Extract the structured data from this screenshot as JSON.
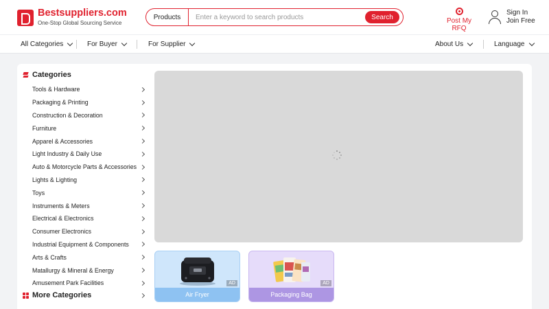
{
  "header": {
    "logo_name": "Bestsuppliers.com",
    "logo_tagline": "One-Stop Global Sourcing Service",
    "search": {
      "category": "Products",
      "placeholder": "Enter a keyword to search products",
      "button": "Search"
    },
    "rfq_label": "Post My RFQ",
    "sign_in": "Sign In",
    "join_free": "Join Free"
  },
  "nav": {
    "all_categories": "All Categories",
    "for_buyer": "For Buyer",
    "for_supplier": "For Supplier",
    "about_us": "About Us",
    "language": "Language"
  },
  "sidebar": {
    "title": "Categories",
    "items": [
      {
        "label": "Tools & Hardware"
      },
      {
        "label": "Packaging & Printing"
      },
      {
        "label": "Construction & Decoration"
      },
      {
        "label": "Furniture"
      },
      {
        "label": "Apparel & Accessories"
      },
      {
        "label": "Light Industry & Daily Use"
      },
      {
        "label": "Auto & Motorcycle Parts & Accessories"
      },
      {
        "label": "Lights & Lighting"
      },
      {
        "label": "Toys"
      },
      {
        "label": "Instruments & Meters"
      },
      {
        "label": "Electrical & Electronics"
      },
      {
        "label": "Consumer Electronics"
      },
      {
        "label": "Industrial Equipment & Components"
      },
      {
        "label": "Arts & Crafts"
      },
      {
        "label": "Matallurgy & Mineral & Energy"
      },
      {
        "label": "Amusement Park Facilities"
      }
    ],
    "more_label": "More Categories"
  },
  "ads": [
    {
      "label": "Air Fryer",
      "badge": "AD"
    },
    {
      "label": "Packaging Bag",
      "badge": "AD"
    }
  ],
  "colors": {
    "brand": "#e0212e",
    "card_air_fryer_bg": "#cfe6fb",
    "card_air_fryer_label": "#8ec2f2",
    "card_bag_bg": "#e6dcfa",
    "card_bag_label": "#ad96e3"
  }
}
